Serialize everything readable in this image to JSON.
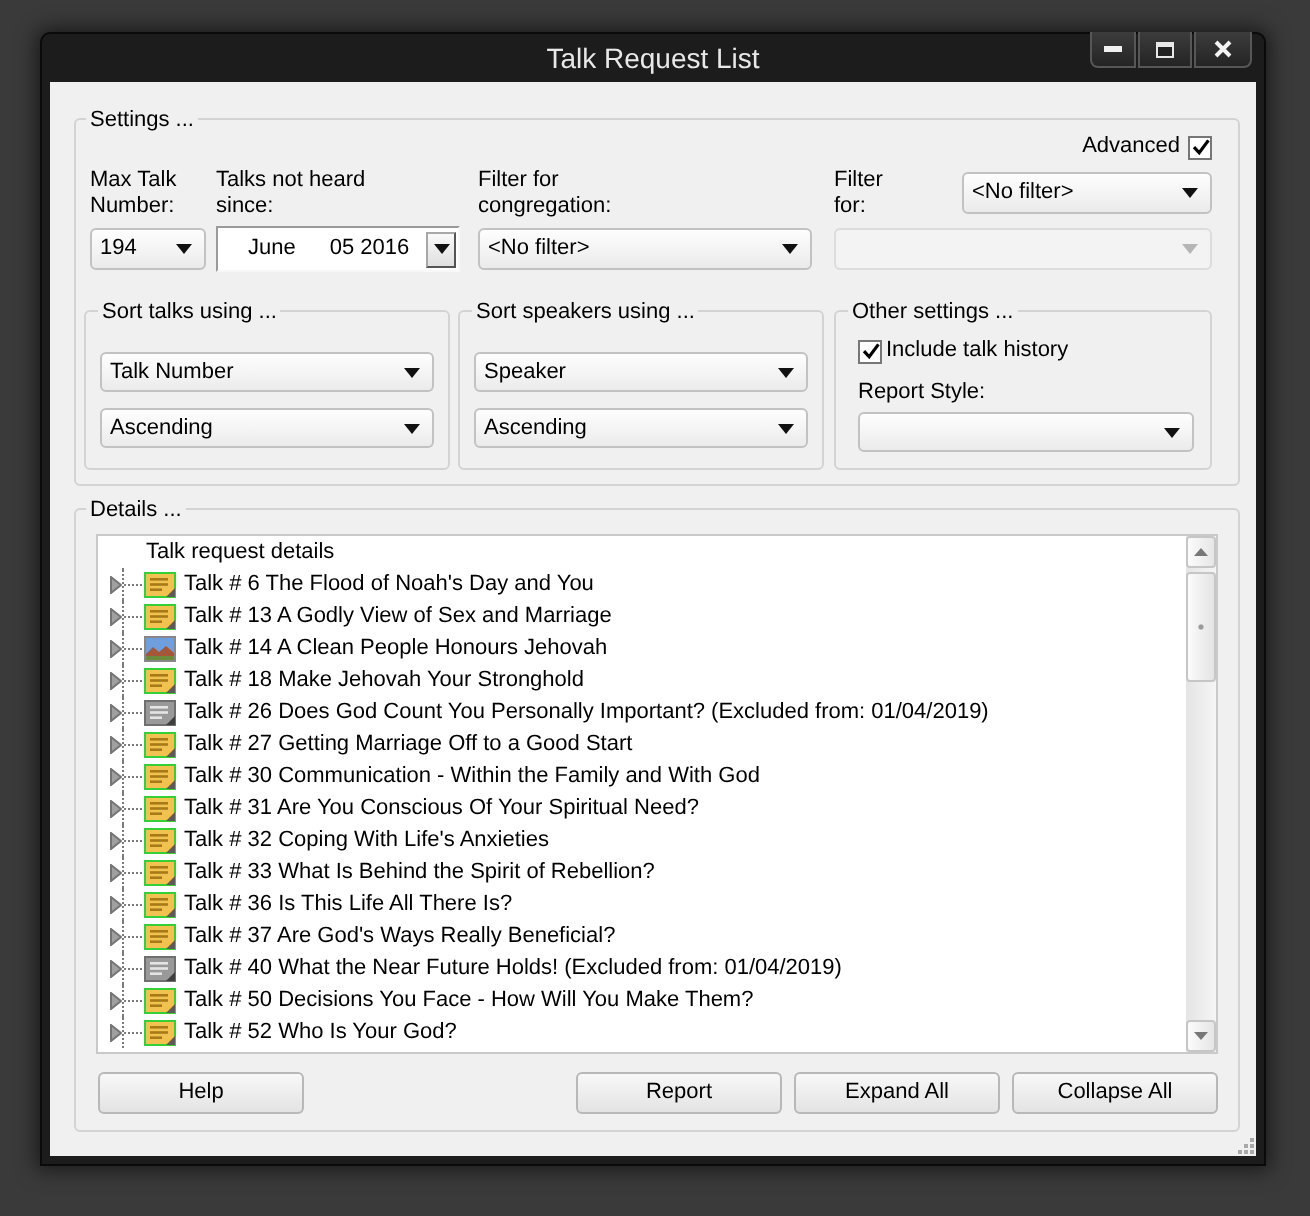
{
  "window": {
    "title": "Talk Request List"
  },
  "settings": {
    "title": "Settings ...",
    "advanced": {
      "label": "Advanced",
      "checked": true
    },
    "max_talk_number": {
      "label": "Max Talk Number:",
      "value": "194"
    },
    "talks_not_heard_since": {
      "label": "Talks not heard since:",
      "month": "June",
      "day_year": "05 2016"
    },
    "filter_for_congregation": {
      "label": "Filter for congregation:",
      "value": "<No filter>"
    },
    "filter_for": {
      "label": "Filter for:",
      "value": "<No filter>"
    },
    "filter_for_detail": {
      "disabled": true
    },
    "sort_talks": {
      "title": "Sort talks using ...",
      "field": "Talk Number",
      "order": "Ascending"
    },
    "sort_speakers": {
      "title": "Sort speakers using ...",
      "field": "Speaker",
      "order": "Ascending"
    },
    "other_settings": {
      "title": "Other settings ...",
      "include_talk_history": {
        "label": "Include talk history",
        "checked": true
      },
      "report_style": {
        "label": "Report Style:"
      }
    }
  },
  "details": {
    "title": "Details ...",
    "tree": {
      "header": "Talk request details",
      "items": [
        {
          "label": "Talk # 6 The Flood of Noah's Day and You",
          "kind": "note",
          "expanded": false
        },
        {
          "label": "Talk # 13 A Godly View of Sex and Marriage",
          "kind": "note",
          "expanded": false
        },
        {
          "label": "Talk # 14 A Clean People Honours Jehovah",
          "kind": "photo",
          "expanded": false
        },
        {
          "label": "Talk # 18 Make Jehovah Your Stronghold",
          "kind": "note",
          "expanded": false
        },
        {
          "label": "Talk # 26 Does God Count You Personally Important? (Excluded from: 01/04/2019)",
          "kind": "inactive",
          "expanded": false
        },
        {
          "label": "Talk # 27 Getting Marriage Off to a Good Start",
          "kind": "note",
          "expanded": false
        },
        {
          "label": "Talk # 30 Communication - Within the Family and With God",
          "kind": "note",
          "expanded": false
        },
        {
          "label": "Talk # 31 Are You Conscious Of Your Spiritual Need?",
          "kind": "note",
          "expanded": false
        },
        {
          "label": "Talk # 32 Coping With Life's Anxieties",
          "kind": "note",
          "expanded": false
        },
        {
          "label": "Talk # 33 What Is Behind the Spirit of Rebellion?",
          "kind": "note",
          "expanded": false
        },
        {
          "label": "Talk # 36 Is This Life All There Is?",
          "kind": "note",
          "expanded": false
        },
        {
          "label": "Talk # 37 Are God's Ways Really Beneficial?",
          "kind": "note",
          "expanded": false
        },
        {
          "label": "Talk # 40 What the Near Future Holds! (Excluded from: 01/04/2019)",
          "kind": "inactive",
          "expanded": false
        },
        {
          "label": "Talk # 50 Decisions You Face - How Will You Make Them?",
          "kind": "note",
          "expanded": false
        },
        {
          "label": "Talk # 52 Who Is Your God?",
          "kind": "note",
          "expanded": false
        }
      ]
    }
  },
  "left_buttons": [
    "Help"
  ],
  "right_buttons": [
    "Report",
    "Expand All",
    "Collapse All"
  ]
}
